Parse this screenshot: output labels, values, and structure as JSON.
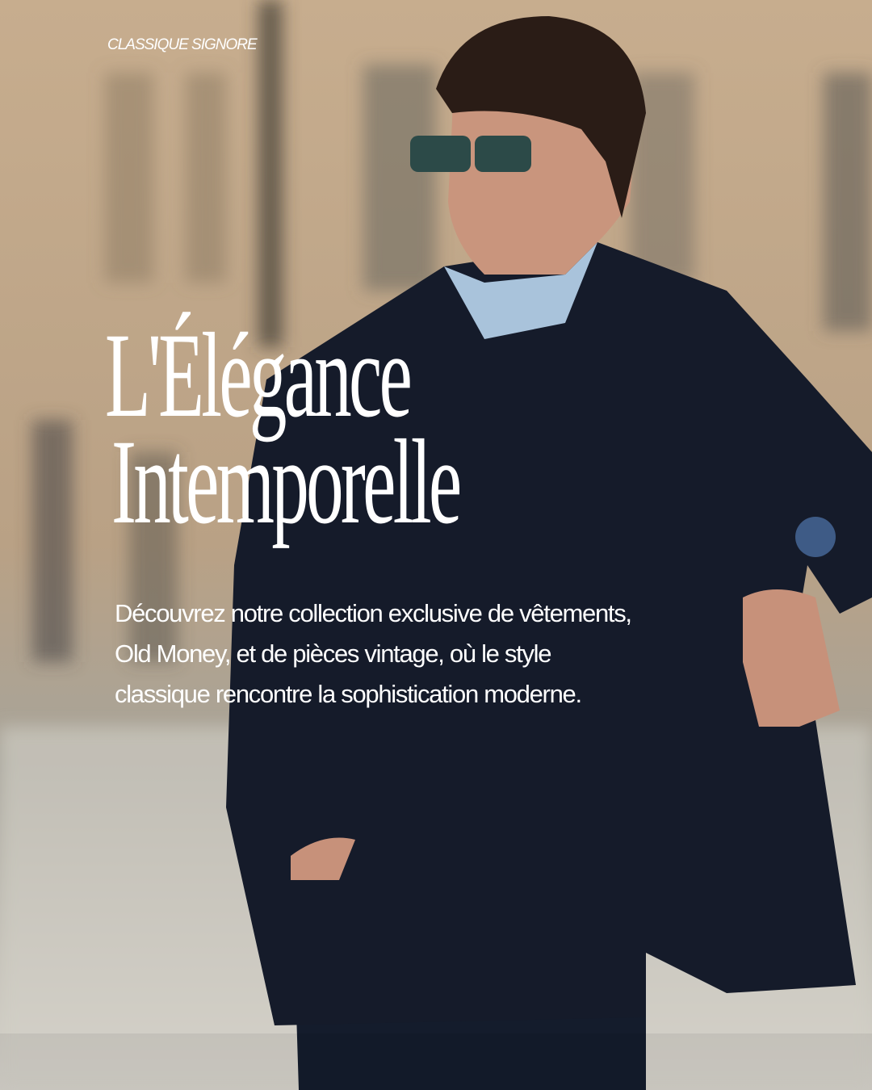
{
  "brand": "CLASSIQUE SIGNORE",
  "headline": {
    "line1": "L'Élégance",
    "line2": "Intemporelle"
  },
  "description": {
    "lines": [
      "Découvrez notre collection exclusive de vêtements,",
      "Old Money, et de pièces vintage, où le style",
      "classique rencontre la sophistication moderne."
    ]
  },
  "colors": {
    "text": "#ffffff",
    "navy": "#141b2b",
    "background": "#c9b49a"
  }
}
